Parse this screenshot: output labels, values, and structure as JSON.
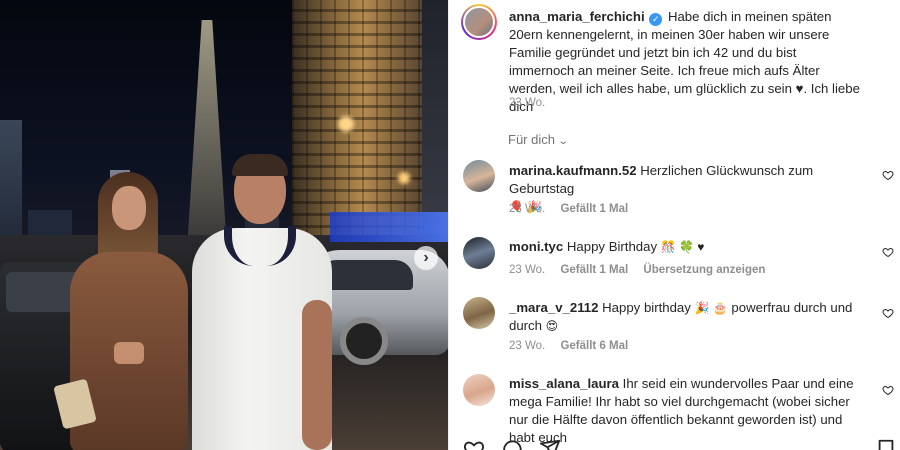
{
  "post": {
    "author": "anna_maria_ferchichi",
    "caption": "Habe dich in meinen späten 20ern kennengelernt, in meinen 30er haben wir unsere Familie gegründet und jetzt bin ich 42 und du bist immernoch an meiner Seite. Ich freue mich aufs Älter werden, weil ich alles habe, um glücklich zu sein",
    "caption_heart": "♥",
    "caption_end": ". Ich liebe dich",
    "age": "23 Wo.",
    "verified_icon": "verified-badge-icon"
  },
  "for_you": {
    "label": "Für dich"
  },
  "comments": [
    {
      "user": "marina.kaufmann.52",
      "text": "Herzlichen Glückwunsch zum Geburtstag",
      "emoji": "🎈 🎉",
      "age": "23 Wo.",
      "likes": "Gefällt 1 Mal",
      "extra": ""
    },
    {
      "user": "moni.tyc",
      "text": "Happy Birthday",
      "emoji": "🎊 🍀 ♥",
      "age": "23 Wo.",
      "likes": "Gefällt 1 Mal",
      "extra": "Übersetzung anzeigen"
    },
    {
      "user": "_mara_v_2112",
      "text": "Happy birthday",
      "emoji": "🎉 🎂",
      "text2": "powerfrau durch und durch",
      "emoji2": "😍",
      "age": "23 Wo.",
      "likes": "Gefällt 6 Mal",
      "extra": ""
    },
    {
      "user": "miss_alana_laura",
      "text": "Ihr seid ein wundervolles Paar und eine mega Familie! Ihr habt so viel durchgemacht (wobei sicher nur die Hälfte davon öffentlich bekannt geworden ist) und habt euch",
      "age": "",
      "likes": "",
      "extra": ""
    }
  ],
  "photo": {
    "next_arrow": "›"
  },
  "colors": {
    "accent_blue": "#3897f0",
    "muted_text": "#8e8e8e",
    "text": "#262626"
  },
  "icons": [
    "like-icon",
    "comment-icon",
    "share-icon",
    "save-icon",
    "heart-icon",
    "chevron-down-icon",
    "next-arrow-icon"
  ]
}
